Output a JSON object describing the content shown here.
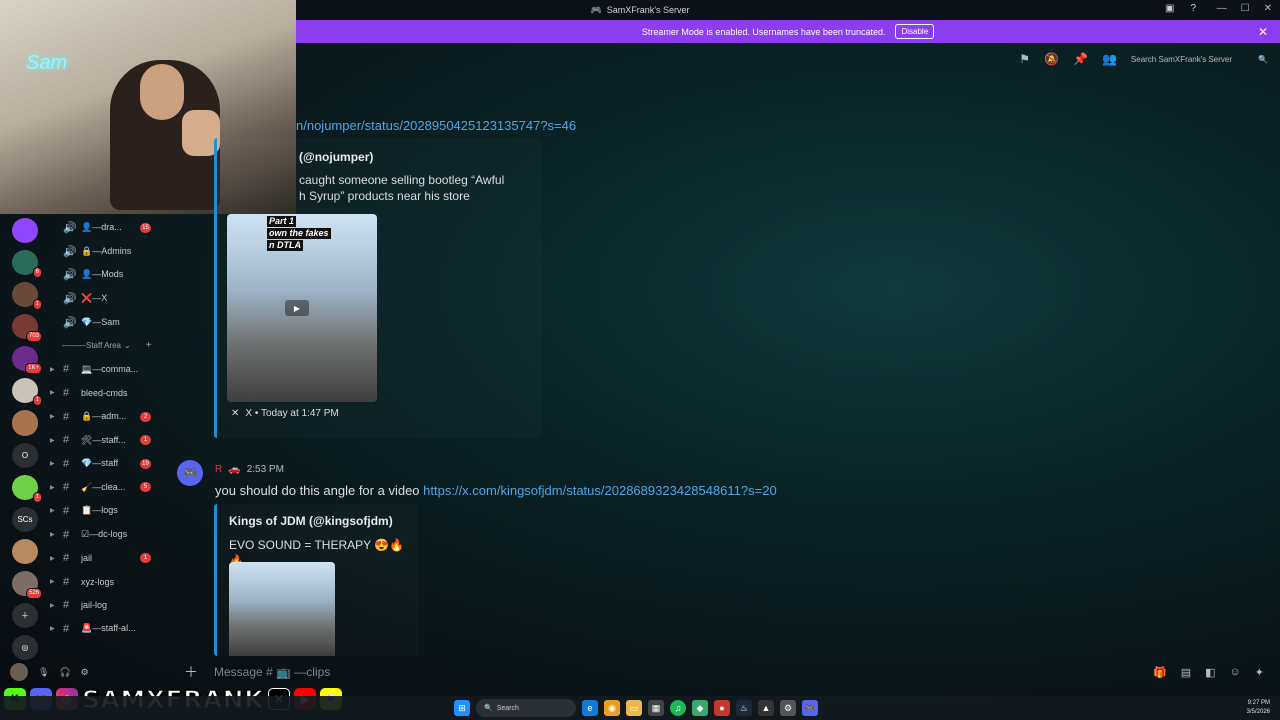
{
  "window": {
    "title": "SamXFrank's Server"
  },
  "banner": {
    "text": "Streamer Mode is enabled. Usernames have been truncated.",
    "disable_label": "Disable"
  },
  "header": {
    "search_placeholder": "Search SamXFrank's Server"
  },
  "servers": [
    {
      "label": "",
      "color": "#9146ff",
      "badge": ""
    },
    {
      "label": "",
      "color": "#2a6b5a",
      "badge": "6"
    },
    {
      "label": "",
      "color": "#6b4a3a",
      "badge": "1"
    },
    {
      "label": "",
      "color": "#7a3a34",
      "badge": "703"
    },
    {
      "label": "",
      "color": "#6a2b8a",
      "badge": "1K+"
    },
    {
      "label": "",
      "color": "#c9c2b8",
      "badge": "1"
    },
    {
      "label": "",
      "color": "#a87450",
      "badge": ""
    },
    {
      "label": "O",
      "color": "#2b2f34",
      "badge": ""
    },
    {
      "label": "",
      "color": "#6fd04a",
      "badge": "1"
    },
    {
      "label": "SCs",
      "color": "#2b2f34",
      "badge": ""
    },
    {
      "label": "",
      "color": "#b88a62",
      "badge": ""
    },
    {
      "label": "",
      "color": "#7a6e66",
      "badge": "526"
    }
  ],
  "channels": [
    {
      "type": "voice",
      "emoji": "👤",
      "name": "—dra...",
      "badge": "15"
    },
    {
      "type": "voice",
      "emoji": "🔒",
      "name": "—Admins",
      "badge": ""
    },
    {
      "type": "voice",
      "emoji": "👤",
      "name": "—Mods",
      "badge": ""
    },
    {
      "type": "voice",
      "emoji": "❌",
      "name": "—X",
      "badge": ""
    },
    {
      "type": "voice",
      "emoji": "💎",
      "name": "—Sam",
      "badge": ""
    }
  ],
  "category": {
    "label": "———Staff Area"
  },
  "staff_channels": [
    {
      "emoji": "💻",
      "name": "—comma...",
      "badge": ""
    },
    {
      "emoji": "",
      "name": "bleed-cmds",
      "badge": ""
    },
    {
      "emoji": "🔒",
      "name": "—adm...",
      "badge": "2"
    },
    {
      "emoji": "🛠",
      "name": "—staff...",
      "badge": "1"
    },
    {
      "emoji": "💎",
      "name": "—staff",
      "badge": "19"
    },
    {
      "emoji": "🧹",
      "name": "—clea...",
      "badge": "5"
    },
    {
      "emoji": "📋",
      "name": "—logs",
      "badge": ""
    },
    {
      "emoji": "☑",
      "name": "—dc-logs",
      "badge": ""
    },
    {
      "emoji": "",
      "name": "jail",
      "badge": "1"
    },
    {
      "emoji": "",
      "name": "xyz-logs",
      "badge": ""
    },
    {
      "emoji": "",
      "name": "jail-log",
      "badge": ""
    },
    {
      "emoji": "🚨",
      "name": "—staff-al...",
      "badge": ""
    }
  ],
  "message1": {
    "link": "n/nojumper/status/2028950425123135747?s=46",
    "embed_title": "(@nojumper)",
    "embed_desc_line1": "caught someone selling bootleg “Awful",
    "embed_desc_line2": "h Syrup” products near his store",
    "video_overlay_line1": "Part 1",
    "video_overlay_line2": "own the fakes",
    "video_overlay_line3": "n DTLA",
    "footer": "X • Today at 1:47 PM"
  },
  "message2": {
    "author": "R",
    "time": "2:53 PM",
    "text": "you should do this angle for a video",
    "link": "https://x.com/kingsofjdm/status/2028689323428548611?s=20",
    "embed_title": "Kings of JDM (@kingsofjdm)",
    "embed_desc": "EVO SOUND = THERAPY 😍🔥🔥"
  },
  "input": {
    "placeholder": "Message # 📺 —clips"
  },
  "socials": {
    "brand": "SAMXFRANK"
  },
  "taskbar": {
    "search_label": "Search",
    "time": "9:27 PM",
    "date": "3/5/2026"
  },
  "colors": {
    "accent": "#8c3df0",
    "link": "#4fa6e8",
    "embed_border": "#1f8fd6",
    "badge": "#e23c3c"
  }
}
